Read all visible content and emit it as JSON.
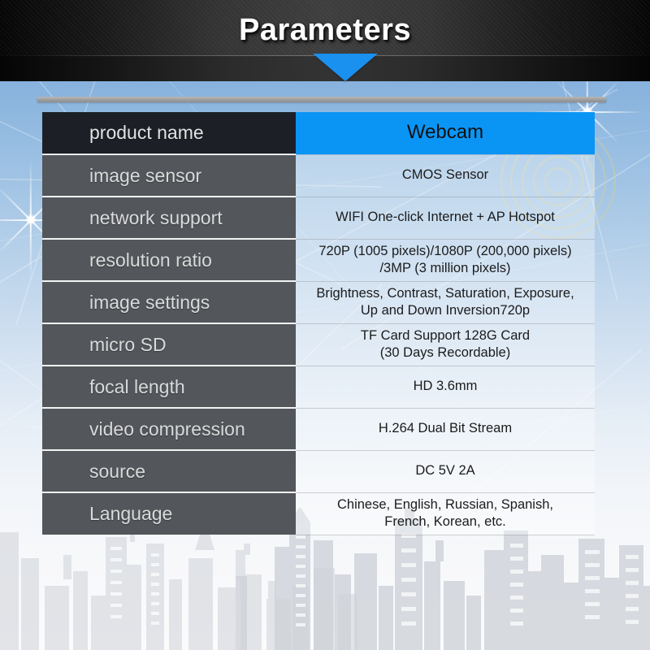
{
  "header": {
    "title": "Parameters",
    "arrow_icon": "triangle-down-icon",
    "accent_color": "#1a90ef",
    "banner_color": "#343434"
  },
  "decor": {
    "divider_bar": "horizontal-gray-bar",
    "skyline": "city-skyline-silhouette",
    "rings": "wifi-concentric-rings",
    "flares": "lens-flare-stars",
    "sky_top_color": "#87b2dd",
    "sky_bottom_color": "#fbfbfc"
  },
  "table": {
    "highlight_color": "#0a95f5",
    "label_color": "#53565a",
    "first_label_color": "#1c2026",
    "rows": [
      {
        "label": "product name",
        "value_lines": [
          "Webcam"
        ]
      },
      {
        "label": "image sensor",
        "value_lines": [
          "CMOS Sensor"
        ]
      },
      {
        "label": "network support",
        "value_lines": [
          "WIFI One-click Internet + AP Hotspot"
        ]
      },
      {
        "label": "resolution ratio",
        "value_lines": [
          "720P (1005 pixels)/1080P (200,000 pixels)",
          "/3MP (3 million pixels)"
        ]
      },
      {
        "label": "image settings",
        "value_lines": [
          "Brightness, Contrast, Saturation, Exposure,",
          "Up and Down Inversion720p"
        ]
      },
      {
        "label": "micro SD",
        "value_lines": [
          "TF Card Support 128G Card",
          "(30 Days Recordable)"
        ]
      },
      {
        "label": "focal length",
        "value_lines": [
          "HD 3.6mm"
        ]
      },
      {
        "label": "video compression",
        "value_lines": [
          "H.264 Dual Bit Stream"
        ]
      },
      {
        "label": "source",
        "value_lines": [
          "DC 5V 2A"
        ]
      },
      {
        "label": "Language",
        "value_lines": [
          "Chinese, English, Russian, Spanish,",
          "French, Korean, etc."
        ]
      }
    ]
  }
}
